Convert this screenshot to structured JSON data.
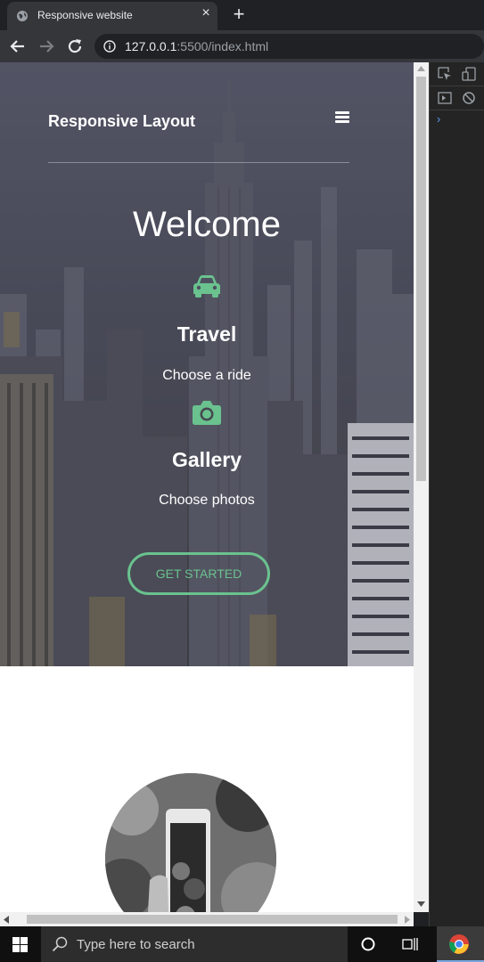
{
  "browser": {
    "tab_title": "Responsive website",
    "close_symbol": "×",
    "newtab_symbol": "+",
    "url_host": "127.0.0.1",
    "url_path": ":5500/index.html"
  },
  "site": {
    "brand": "Responsive Layout",
    "welcome": "Welcome",
    "features": [
      {
        "icon": "car-icon",
        "title": "Travel",
        "subtitle": "Choose a ride"
      },
      {
        "icon": "camera-icon",
        "title": "Gallery",
        "subtitle": "Choose photos"
      }
    ],
    "cta_label": "GET STARTED",
    "accent_color": "#6ac28f"
  },
  "devtools": {
    "prompt_symbol": "›"
  },
  "taskbar": {
    "search_placeholder": "Type here to search"
  }
}
